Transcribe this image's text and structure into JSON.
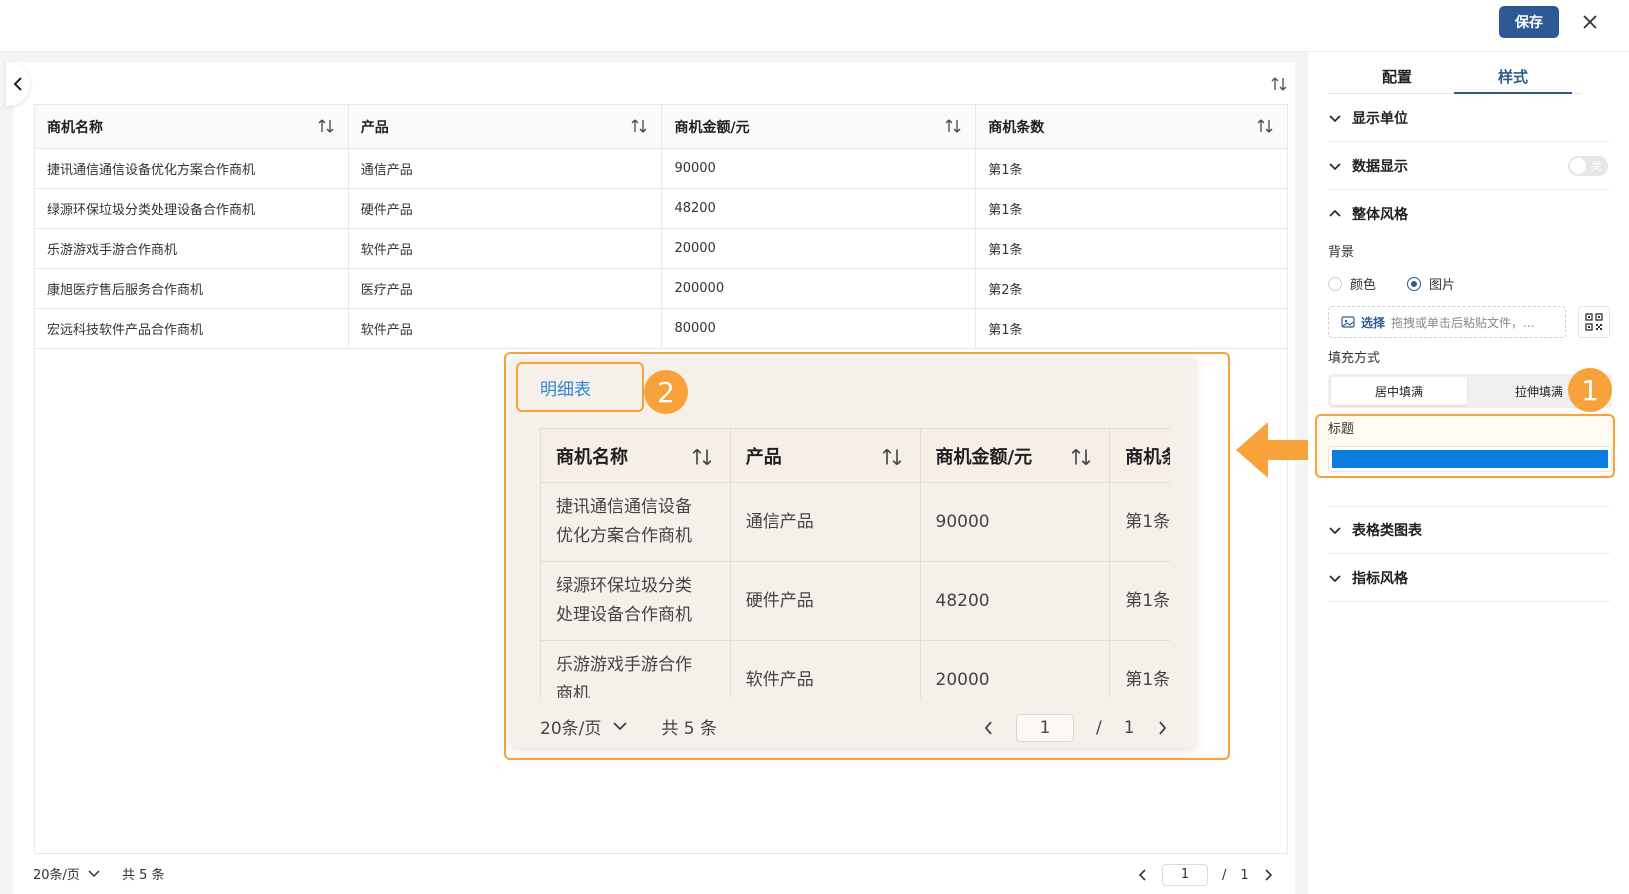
{
  "topbar": {
    "save_label": "保存"
  },
  "table": {
    "columns": [
      "商机名称",
      "产品",
      "商机金额/元",
      "商机条数"
    ],
    "rows": [
      [
        "捷讯通信通信设备优化方案合作商机",
        "通信产品",
        "90000",
        "第1条"
      ],
      [
        "绿源环保垃圾分类处理设备合作商机",
        "硬件产品",
        "48200",
        "第1条"
      ],
      [
        "乐游游戏手游合作商机",
        "软件产品",
        "20000",
        "第1条"
      ],
      [
        "康旭医疗售后服务合作商机",
        "医疗产品",
        "200000",
        "第2条"
      ],
      [
        "宏远科技软件产品合作商机",
        "软件产品",
        "80000",
        "第1条"
      ]
    ]
  },
  "pager": {
    "page_size": "20条/页",
    "total": "共 5 条",
    "current": "1",
    "sep": "/",
    "pages": "1"
  },
  "sidebar": {
    "tabs": [
      "配置",
      "样式"
    ],
    "sections": {
      "display_unit": "显示单位",
      "data_display": "数据显示",
      "toggle_label": "关",
      "overall_style": "整体风格",
      "table_chart": "表格类图表",
      "indicator_style": "指标风格"
    },
    "background_label": "背景",
    "bg_options": [
      "颜色",
      "图片"
    ],
    "upload_select": "选择",
    "upload_hint": "拖拽或单击后粘贴文件，...",
    "fill_mode_label": "填充方式",
    "fill_modes": [
      "居中填满",
      "拉伸填满"
    ],
    "title_label": "标题",
    "title_color": "#0b7de0"
  },
  "callout": {
    "title": "明细表",
    "columns": [
      "商机名称",
      "产品",
      "商机金额/元",
      "商机条"
    ],
    "rows": [
      [
        "捷讯通信通信设备\n优化方案合作商机",
        "通信产品",
        "90000",
        "第1条"
      ],
      [
        "绿源环保垃圾分类\n处理设备合作商机",
        "硬件产品",
        "48200",
        "第1条"
      ],
      [
        "乐游游戏手游合作\n商机",
        "软件产品",
        "20000",
        "第1条"
      ]
    ],
    "page_size": "20条/页",
    "total": "共 5 条",
    "current": "1",
    "sep": "/",
    "pages": "1"
  },
  "badges": [
    "1",
    "2"
  ],
  "colors": {
    "accent": "#2d5a93",
    "highlight": "#f7a23a"
  }
}
